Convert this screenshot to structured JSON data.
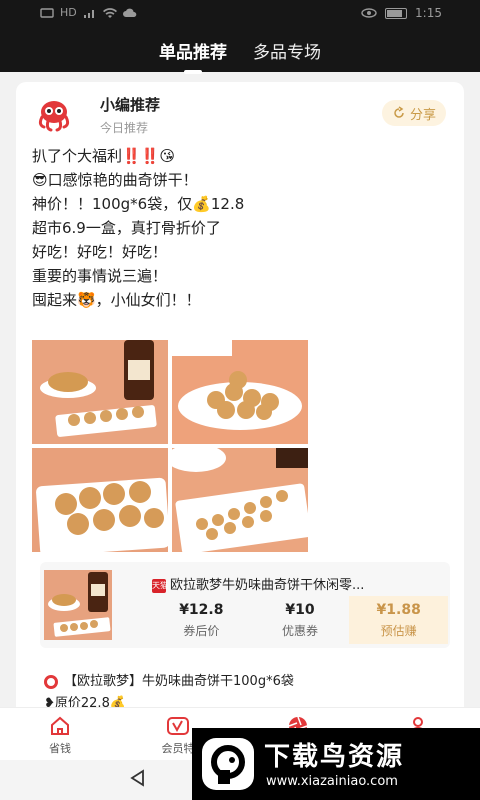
{
  "status_bar": {
    "time": "1:15",
    "carrier": "HD"
  },
  "tabs": [
    {
      "label": "单品推荐",
      "active": true
    },
    {
      "label": "多品专场",
      "active": false
    }
  ],
  "post": {
    "author_name": "小编推荐",
    "author_sub": "今日推荐",
    "share_label": "分享",
    "text_lines": [
      "扒了个大福利‼️‼️😘",
      "😎口感惊艳的曲奇饼干！",
      "神价！！100g*6袋，仅💰12.8",
      "超市6.9一盒，真打骨折价了",
      "好吃！好吃！好吃！",
      "重要的事情说三遍！",
      "囤起来🐯，小仙女们！！"
    ]
  },
  "product": {
    "title": "欧拉歌梦牛奶味曲奇饼干休闲零...",
    "store_badge": "天猫",
    "after_coupon_price": "¥12.8",
    "after_coupon_label": "券后价",
    "coupon_value": "¥10",
    "coupon_label": "优惠券",
    "earn_value": "¥1.88",
    "earn_label": "预估赚"
  },
  "next_post": {
    "title": "【欧拉歌梦】牛奶味曲奇饼干100g*6袋",
    "price_line": "❥原价22.8💰"
  },
  "bottom_nav": [
    {
      "label": "省钱"
    },
    {
      "label": "会员特"
    },
    {
      "label": ""
    },
    {
      "label": ""
    }
  ],
  "watermark": {
    "title": "下载鸟资源",
    "url": "www.xiazainiao.com"
  },
  "colors": {
    "header_bg": "#161616",
    "accent_gold": "#c9954a",
    "accent_red": "#e2383a"
  }
}
